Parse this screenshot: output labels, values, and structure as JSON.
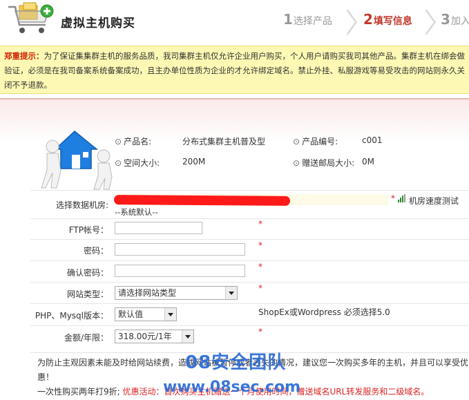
{
  "header": {
    "title": "虚拟主机购买",
    "steps": [
      {
        "num": "1",
        "label": "选择产品"
      },
      {
        "num": "2",
        "label": "填写信息"
      },
      {
        "num": "3",
        "label": "加入"
      }
    ],
    "active_step": 2
  },
  "warning": {
    "title": "郑重提示：",
    "text": "为了保证集集群主机的服务品质，我司集群主机仅允许企业用户购买，个人用户请购买我司其他产品。集群主机在绑会做验证，必须是在我司备案系统备案成功，且主办单位性质为企业的才允许绑定域名。禁止外挂、私服游戏等易受攻击的网站则永久关闭不予退款。"
  },
  "product": {
    "name_label": "产品名:",
    "name_value": "分布式集群主机普及型",
    "code_label": "产品编号:",
    "code_value": "c001",
    "space_label": "空间大小:",
    "space_value": "200M",
    "mail_label": "赠送邮局大小:",
    "mail_value": "0M"
  },
  "form": {
    "datacenter_label": "选择数据机房:",
    "datacenter_default": "--系统默认--",
    "speed_test_label": "机房速度测试",
    "ftp_label": "FTP帐号：",
    "password_label": "密码：",
    "confirm_label": "确认密码：",
    "site_type_label": "网站类型：",
    "site_type_value": "请选择网站类型",
    "php_label": "PHP、Mysql版本：",
    "php_value": "默认值",
    "php_hint": "ShopEx或Wordpress 必须选择5.0",
    "price_label": "金额/年限：",
    "price_value": "318.00元/1年",
    "required_mark": "*"
  },
  "note": {
    "line1": "为防止主观因素未能及时给网站续费，造成网站被暂停或者丢失的情况，建议您一次购买多年的主机，并且可以享受优",
    "line2": "惠！",
    "line3_plain": "一次性购买两年打9折;",
    "line3_promo": "优惠活动：首次购买主机赠送一个月使用时间，赠送域名URL转发服务和二级域名。"
  },
  "watermark": {
    "line1": "08安全团队",
    "line2": "www.08sec.com"
  },
  "colors": {
    "accent_red": "#c0392b",
    "warning_bg": "#fdf9b4",
    "watermark_blue": "#2a6bd6",
    "required_red": "#e02020"
  }
}
